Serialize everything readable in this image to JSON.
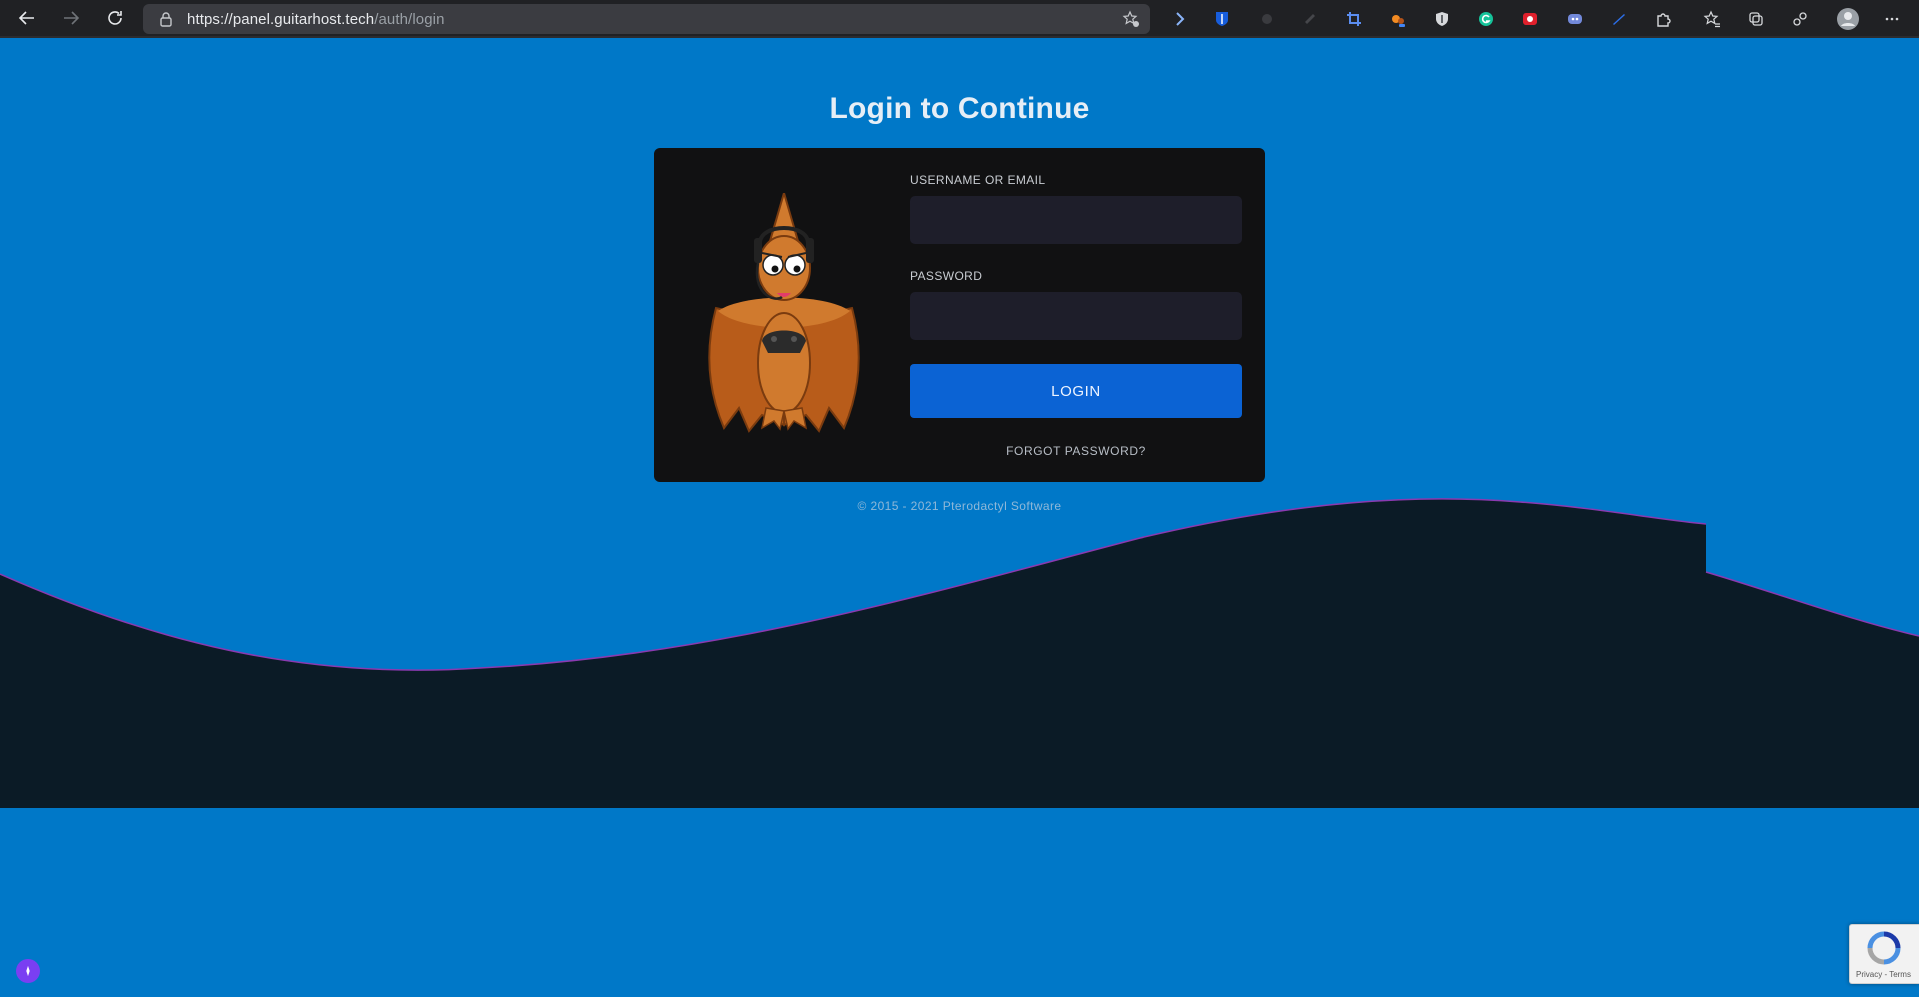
{
  "browser": {
    "url_domain": "https://panel.guitarhost.tech",
    "url_path": "/auth/login"
  },
  "page": {
    "title": "Login to Continue",
    "username_label": "USERNAME OR EMAIL",
    "username_value": "",
    "password_label": "PASSWORD",
    "password_value": "",
    "login_button": "LOGIN",
    "forgot_link": "FORGOT PASSWORD?",
    "copyright": "© 2015 - 2021 Pterodactyl Software"
  },
  "recaptcha": {
    "text": "Privacy - Terms"
  },
  "colors": {
    "background": "#0078c8",
    "wave": "#0b1b26",
    "card": "#111112",
    "input": "#1e1e2a",
    "button": "#0b63d4"
  },
  "icons": [
    "back-icon",
    "forward-icon",
    "reload-icon",
    "lock-icon",
    "favorite-add-icon",
    "extension-icon",
    "favorites-icon",
    "collections-icon",
    "profile-icon",
    "more-icon"
  ]
}
